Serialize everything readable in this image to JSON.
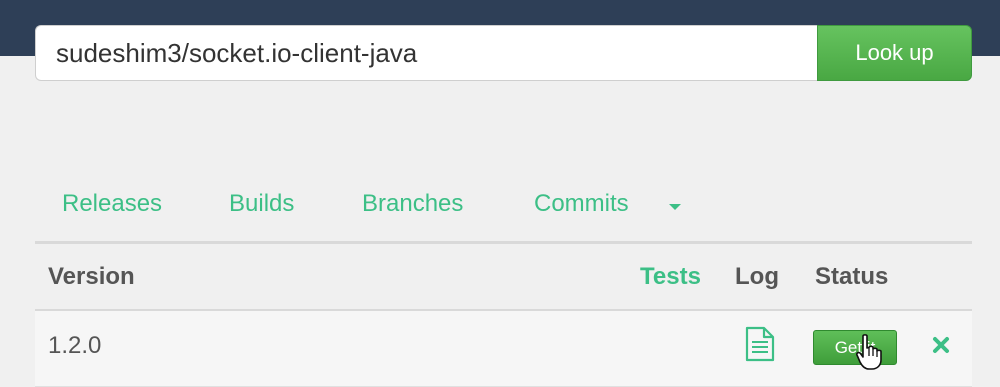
{
  "header": {
    "search_value": "sudeshim3/socket.io-client-java",
    "lookup_label": "Look up"
  },
  "tabs": [
    {
      "label": "Releases"
    },
    {
      "label": "Builds"
    },
    {
      "label": "Branches"
    },
    {
      "label": "Commits"
    }
  ],
  "table": {
    "headers": {
      "version": "Version",
      "tests": "Tests",
      "log": "Log",
      "status": "Status"
    },
    "rows": [
      {
        "version": "1.2.0",
        "log_icon": "document-icon",
        "status_label": "Get it",
        "remove_icon": "close-icon"
      }
    ]
  },
  "colors": {
    "topbar": "#2e3f57",
    "accent": "#3cbf86",
    "button_green": "#49a843",
    "background": "#f0f0f0"
  }
}
